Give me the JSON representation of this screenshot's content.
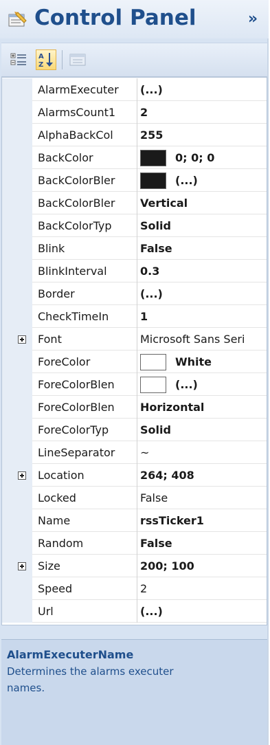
{
  "header": {
    "title": "Control Panel",
    "collapse_glyph": "»",
    "icon": "properties-window-icon"
  },
  "toolbar": {
    "buttons": [
      {
        "name": "categorized",
        "icon": "categorized-view-icon",
        "active": false
      },
      {
        "name": "alphabetical",
        "icon": "sort-alphabetical-icon",
        "active": true
      },
      {
        "name": "property-pages",
        "icon": "property-pages-icon",
        "active": false
      }
    ]
  },
  "properties": [
    {
      "name": "AlarmExecuter",
      "value": "(...)",
      "bold": true
    },
    {
      "name": "AlarmsCount1",
      "value": "2",
      "bold": true
    },
    {
      "name": "AlphaBackCol",
      "value": "255",
      "bold": true
    },
    {
      "name": "BackColor",
      "value": "0; 0; 0",
      "bold": true,
      "swatch": "#1a1a1a"
    },
    {
      "name": "BackColorBler",
      "value": "(...)",
      "bold": true,
      "swatch": "#1a1a1a"
    },
    {
      "name": "BackColorBler",
      "value": "Vertical",
      "bold": true
    },
    {
      "name": "BackColorTyp",
      "value": "Solid",
      "bold": true
    },
    {
      "name": "Blink",
      "value": "False",
      "bold": true
    },
    {
      "name": "BlinkInterval",
      "value": "0.3",
      "bold": true
    },
    {
      "name": "Border",
      "value": "(...)",
      "bold": true
    },
    {
      "name": "CheckTimeIn",
      "value": "1",
      "bold": true
    },
    {
      "name": "Font",
      "value": "Microsoft Sans Seri",
      "bold": false,
      "expandable": true
    },
    {
      "name": "ForeColor",
      "value": "White",
      "bold": true,
      "swatch": "#ffffff"
    },
    {
      "name": "ForeColorBlen",
      "value": "(...)",
      "bold": true,
      "swatch": "#ffffff"
    },
    {
      "name": "ForeColorBlen",
      "value": "Horizontal",
      "bold": true
    },
    {
      "name": "ForeColorTyp",
      "value": "Solid",
      "bold": true
    },
    {
      "name": "LineSeparator",
      "value": "~",
      "bold": false
    },
    {
      "name": "Location",
      "value": "264; 408",
      "bold": true,
      "expandable": true
    },
    {
      "name": "Locked",
      "value": "False",
      "bold": false
    },
    {
      "name": "Name",
      "value": "rssTicker1",
      "bold": true
    },
    {
      "name": "Random",
      "value": "False",
      "bold": true
    },
    {
      "name": "Size",
      "value": "200; 100",
      "bold": true,
      "expandable": true
    },
    {
      "name": "Speed",
      "value": "2",
      "bold": false
    },
    {
      "name": "Url",
      "value": "(...)",
      "bold": true
    }
  ],
  "description": {
    "title": "AlarmExecuterName",
    "text": "Determines the alarms executer names."
  },
  "colors": {
    "title": "#1f4f8c",
    "panel_background": "#d7e3f2",
    "description_background": "#c9d8ec"
  }
}
